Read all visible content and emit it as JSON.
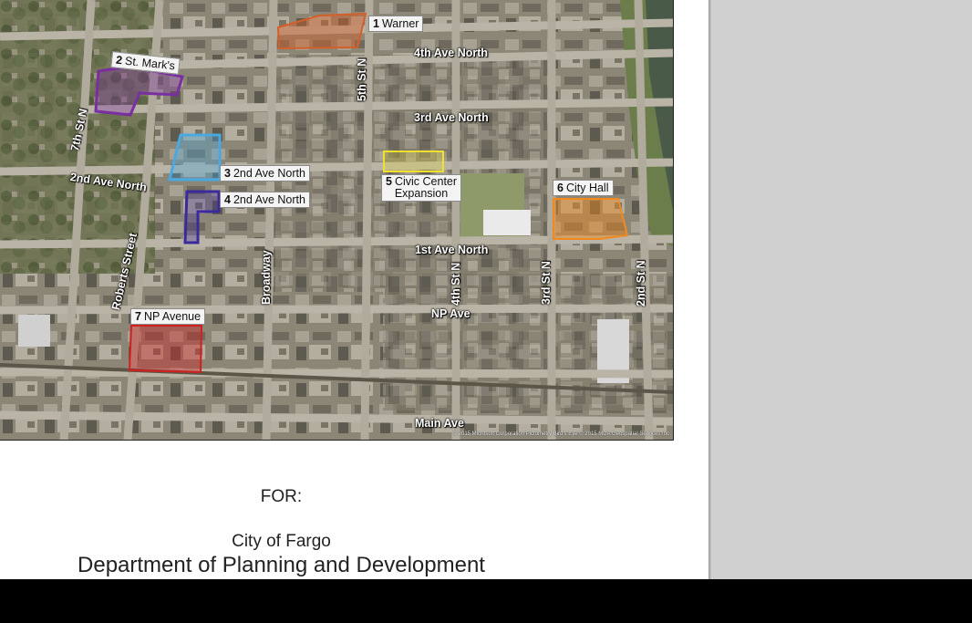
{
  "cover": {
    "for_label": "FOR:",
    "city": "City of Fargo",
    "department": "Department of Planning and Development"
  },
  "map": {
    "sites": [
      {
        "number": "1",
        "name": "Warner",
        "color": "#d2602a"
      },
      {
        "number": "2",
        "name": "St. Mark's",
        "color": "#7a2fa0"
      },
      {
        "number": "3",
        "name": "2nd Ave North",
        "color": "#4aa8e0"
      },
      {
        "number": "4",
        "name": "2nd Ave North",
        "color": "#3b2a9a"
      },
      {
        "number": "5",
        "name_line1": "Civic Center",
        "name_line2": "Expansion",
        "color": "#f0e030"
      },
      {
        "number": "6",
        "name": "City Hall",
        "color": "#f08a20"
      },
      {
        "number": "7",
        "name": "NP Avenue",
        "color": "#d02020"
      }
    ],
    "streets": {
      "ave_4th": "4th Ave North",
      "ave_3rd": "3rd Ave North",
      "ave_2nd": "2nd Ave North",
      "ave_1st": "1st Ave North",
      "np_ave": "NP Ave",
      "main_ave": "Main Ave",
      "st_7th": "7th St N",
      "st_5th": "5th St N",
      "st_4th": "4th St N",
      "st_3rd": "3rd St N",
      "st_2nd": "2nd St N",
      "roberts": "Roberts Street",
      "broadway": "Broadway"
    },
    "credit": "© 2015 Microsoft Corporation   Pictometry Bird's Eye © 2015 MDA Geospatial Services Inc"
  }
}
